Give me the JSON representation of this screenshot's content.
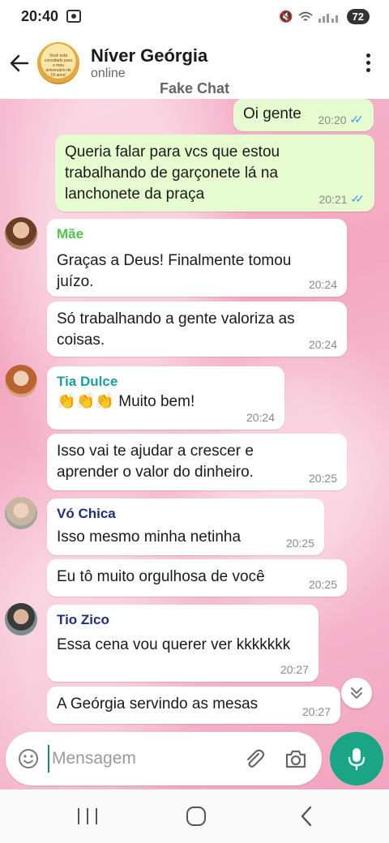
{
  "status": {
    "time": "20:40",
    "battery": "72"
  },
  "header": {
    "title": "Níver Geórgia",
    "subtitle": "online",
    "watermark": "Fake Chat",
    "avatar_text": "Você está convidado para o meu aniversário de 18 anos!"
  },
  "messages": [
    {
      "direction": "out",
      "text": "Oi gente",
      "time": "20:20",
      "read": true
    },
    {
      "direction": "out",
      "text": "Queria falar para vcs que estou trabalhando de garçonete lá na lanchonete da praça",
      "time": "20:21",
      "read": true
    },
    {
      "direction": "in",
      "sender": "Mãe",
      "sender_color": "#54c24e",
      "text": "Graças a Deus! Finalmente tomou juízo.",
      "time": "20:24"
    },
    {
      "direction": "in",
      "text": "Só trabalhando a gente valoriza as coisas.",
      "time": "20:24"
    },
    {
      "direction": "in",
      "sender": "Tia Dulce",
      "sender_color": "#1c9e9a",
      "text": "👏👏👏 Muito bem!",
      "time": "20:24"
    },
    {
      "direction": "in",
      "text": "Isso vai te ajudar a crescer e aprender o valor do dinheiro.",
      "time": "20:25"
    },
    {
      "direction": "in",
      "sender": "Vó Chica",
      "sender_color": "#1f2f7a",
      "text": "Isso mesmo minha netinha",
      "time": "20:25"
    },
    {
      "direction": "in",
      "text": "Eu tô muito orgulhosa de você",
      "time": "20:25"
    },
    {
      "direction": "in",
      "sender": "Tio Zico",
      "sender_color": "#1f2f7a",
      "text": "Essa cena vou querer ver kkkkkkk",
      "time": "20:27"
    },
    {
      "direction": "in",
      "text": "A Geórgia servindo as mesas",
      "time": "20:27"
    }
  ],
  "composer": {
    "placeholder": "Mensagem"
  },
  "colors": {
    "accent": "#1aa686",
    "outgoing_bubble": "#e6fcd0",
    "incoming_bubble": "#ffffff",
    "read_ticks": "#3b9be8"
  }
}
